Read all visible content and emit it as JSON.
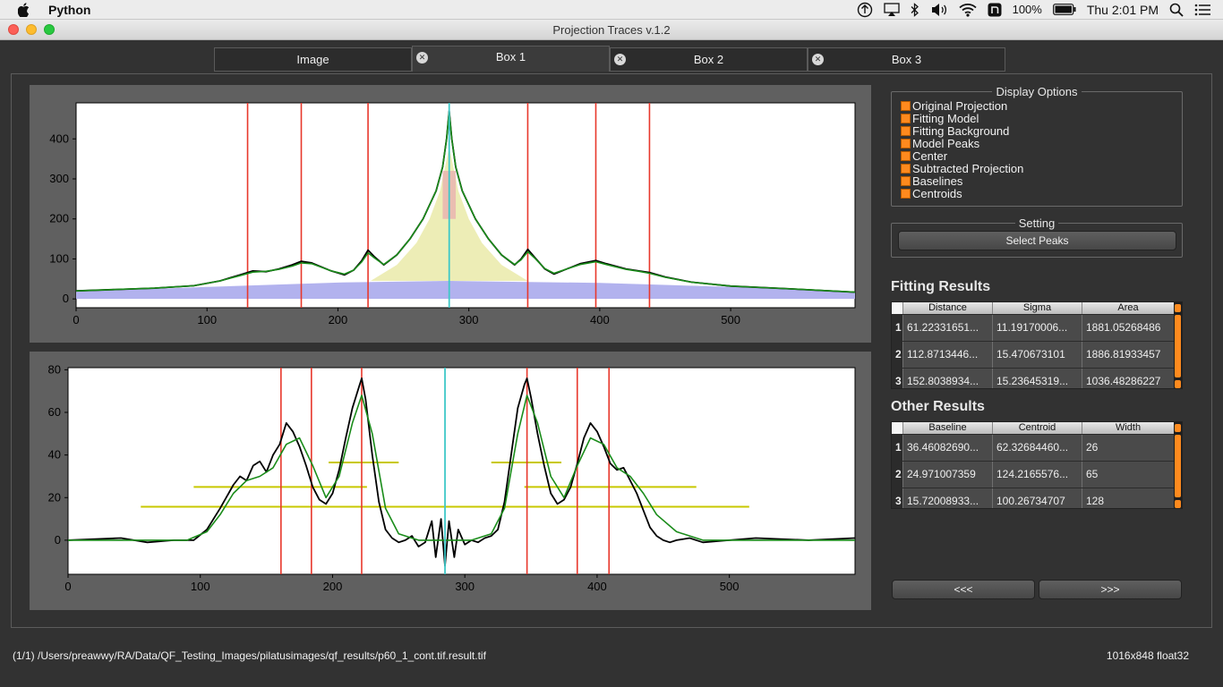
{
  "menubar": {
    "app_name": "Python",
    "battery": "100%",
    "clock": "Thu 2:01 PM"
  },
  "window": {
    "title": "Projection Traces v.1.2"
  },
  "tabs": [
    {
      "label": "Image"
    },
    {
      "label": "Box 1",
      "close": "✕"
    },
    {
      "label": "Box 2",
      "close": "✕"
    },
    {
      "label": "Box 3",
      "close": "✕"
    }
  ],
  "display_options": {
    "title": "Display Options",
    "options": [
      "Original Projection",
      "Fitting Model",
      "Fitting Background",
      "Model Peaks",
      "Center",
      "Subtracted Projection",
      "Baselines",
      "Centroids"
    ],
    "checkbox_color": "#ff8a1e"
  },
  "setting": {
    "title": "Setting",
    "select_peaks_label": "Select Peaks"
  },
  "fitting_results": {
    "title": "Fitting Results",
    "columns": [
      "Distance",
      "Sigma",
      "Area"
    ],
    "rows": [
      {
        "index": "1",
        "cells": [
          "61.22331651...",
          "11.19170006...",
          "1881.05268486"
        ]
      },
      {
        "index": "2",
        "cells": [
          "112.8713446...",
          "15.470673101",
          "1886.81933457"
        ]
      },
      {
        "index": "3",
        "cells": [
          "152.8038934...",
          "15.23645319...",
          "1036.48286227"
        ]
      }
    ]
  },
  "other_results": {
    "title": "Other Results",
    "columns": [
      "Baseline",
      "Centroid",
      "Width"
    ],
    "rows": [
      {
        "index": "1",
        "cells": [
          "36.46082690...",
          "62.32684460...",
          "26"
        ]
      },
      {
        "index": "2",
        "cells": [
          "24.971007359",
          "124.2165576...",
          "65"
        ]
      },
      {
        "index": "3",
        "cells": [
          "15.72008933...",
          "100.26734707",
          "128"
        ]
      }
    ]
  },
  "nav": {
    "prev_label": "<<<",
    "next_label": ">>>"
  },
  "status": {
    "path": "(1/1) /Users/preawwy/RA/Data/QF_Testing_Images/pilatusimages/qf_results/p60_1_cont.tif.result.tif",
    "image_info": "1016x848 float32"
  },
  "colors": {
    "peak_line": "#e8382c",
    "center_line": "#3fc8c8",
    "fit_curve": "#1a8c1a",
    "raw_curve": "#000000",
    "background_fill": "#b2b2ee",
    "model_peak_fill": "#ececb2",
    "baseline": "#c8c800"
  },
  "chart_data": [
    {
      "type": "line",
      "name": "top-projection",
      "xlim": [
        0,
        595
      ],
      "ylim": [
        -22,
        490
      ],
      "xticks": [
        0,
        100,
        200,
        300,
        400,
        500
      ],
      "yticks": [
        0,
        100,
        200,
        300,
        400
      ],
      "center": 285,
      "peak_lines": [
        131,
        172,
        223,
        345,
        397,
        438
      ],
      "series": [
        {
          "name": "Original Projection",
          "x": [
            0,
            60,
            90,
            110,
            125,
            135,
            145,
            155,
            165,
            172,
            180,
            195,
            205,
            212,
            218,
            223,
            228,
            235,
            245,
            255,
            265,
            275,
            280,
            283,
            285,
            287,
            290,
            295,
            305,
            315,
            325,
            335,
            340,
            345,
            350,
            358,
            365,
            375,
            385,
            397,
            405,
            420,
            430,
            438,
            450,
            470,
            500,
            540,
            595
          ],
          "y": [
            20,
            27,
            33,
            45,
            60,
            70,
            68,
            75,
            85,
            94,
            90,
            70,
            60,
            72,
            95,
            122,
            105,
            85,
            110,
            150,
            200,
            270,
            330,
            400,
            470,
            400,
            330,
            270,
            200,
            150,
            110,
            85,
            100,
            124,
            105,
            75,
            62,
            75,
            88,
            96,
            88,
            75,
            70,
            66,
            55,
            42,
            32,
            26,
            17
          ]
        },
        {
          "name": "Fitting Model",
          "x": [
            0,
            60,
            90,
            110,
            125,
            135,
            145,
            155,
            165,
            172,
            180,
            195,
            205,
            212,
            218,
            223,
            228,
            235,
            245,
            255,
            265,
            275,
            280,
            283,
            285,
            287,
            290,
            295,
            305,
            315,
            325,
            335,
            340,
            345,
            350,
            358,
            365,
            375,
            385,
            397,
            405,
            420,
            430,
            438,
            450,
            470,
            500,
            540,
            595
          ],
          "y": [
            20,
            27,
            33,
            45,
            58,
            67,
            69,
            74,
            82,
            90,
            88,
            70,
            62,
            72,
            92,
            115,
            102,
            86,
            110,
            150,
            200,
            270,
            330,
            400,
            468,
            400,
            330,
            270,
            200,
            150,
            110,
            86,
            98,
            118,
            103,
            76,
            64,
            75,
            86,
            93,
            86,
            74,
            69,
            64,
            54,
            42,
            32,
            26,
            17
          ]
        },
        {
          "name": "Fitting Background",
          "x": [
            0,
            100,
            200,
            285,
            400,
            500,
            595
          ],
          "y": [
            18,
            30,
            41,
            45,
            40,
            30,
            18
          ]
        },
        {
          "name": "Model Peaks",
          "x": [
            225,
            245,
            260,
            270,
            278,
            285,
            292,
            300,
            310,
            325,
            345
          ],
          "y": [
            45,
            85,
            140,
            200,
            270,
            380,
            270,
            200,
            140,
            85,
            45
          ]
        }
      ]
    },
    {
      "type": "line",
      "name": "subtracted-projection",
      "xlim": [
        0,
        595
      ],
      "ylim": [
        -16,
        81
      ],
      "xticks": [
        0,
        100,
        200,
        300,
        400,
        500
      ],
      "yticks": [
        0,
        20,
        40,
        60,
        80
      ],
      "center": 285,
      "peak_lines": [
        161,
        184,
        222,
        347,
        385,
        409
      ],
      "series": [
        {
          "name": "Subtracted Projection",
          "x": [
            0,
            40,
            60,
            80,
            95,
            105,
            115,
            125,
            130,
            135,
            140,
            145,
            150,
            155,
            160,
            165,
            170,
            175,
            180,
            185,
            190,
            195,
            200,
            205,
            210,
            215,
            220,
            222,
            225,
            230,
            235,
            240,
            245,
            250,
            255,
            260,
            265,
            270,
            275,
            278,
            282,
            285,
            288,
            292,
            295,
            300,
            305,
            310,
            315,
            320,
            325,
            330,
            335,
            340,
            345,
            347,
            350,
            355,
            360,
            365,
            370,
            375,
            380,
            385,
            390,
            395,
            400,
            405,
            410,
            415,
            420,
            425,
            430,
            435,
            440,
            445,
            450,
            455,
            460,
            470,
            480,
            500,
            520,
            560,
            595
          ],
          "y": [
            0,
            1,
            -1,
            0,
            0,
            5,
            15,
            26,
            30,
            28,
            35,
            37,
            32,
            40,
            45,
            55,
            51,
            44,
            35,
            25,
            19,
            17,
            22,
            33,
            48,
            62,
            72,
            76,
            66,
            40,
            18,
            5,
            1,
            -1,
            0,
            2,
            -3,
            -1,
            9,
            -8,
            10,
            -12,
            9,
            -8,
            5,
            -2,
            0,
            -1,
            1,
            2,
            5,
            18,
            40,
            62,
            73,
            76,
            67,
            50,
            35,
            22,
            17,
            19,
            25,
            36,
            48,
            55,
            51,
            44,
            36,
            33,
            34,
            28,
            22,
            14,
            6,
            2,
            0,
            -1,
            0,
            1,
            -1,
            0,
            1,
            0,
            1
          ]
        },
        {
          "name": "Fitting Model",
          "x": [
            0,
            90,
            105,
            115,
            125,
            135,
            145,
            155,
            165,
            175,
            185,
            195,
            205,
            215,
            222,
            230,
            240,
            250,
            265,
            285,
            305,
            320,
            330,
            340,
            347,
            355,
            365,
            375,
            385,
            395,
            405,
            415,
            425,
            435,
            445,
            460,
            480,
            595
          ],
          "y": [
            0,
            0,
            4,
            12,
            22,
            28,
            30,
            34,
            45,
            48,
            35,
            20,
            30,
            55,
            68,
            50,
            15,
            3,
            0,
            0,
            0,
            3,
            15,
            50,
            68,
            55,
            30,
            20,
            35,
            48,
            45,
            34,
            30,
            22,
            12,
            4,
            0,
            0
          ]
        }
      ],
      "baselines": [
        {
          "y": 36.5,
          "x0": 197,
          "x1": 250
        },
        {
          "y": 36.5,
          "x0": 320,
          "x1": 373
        },
        {
          "y": 25,
          "x0": 95,
          "x1": 226
        },
        {
          "y": 25,
          "x0": 345,
          "x1": 475
        },
        {
          "y": 15.7,
          "x0": 55,
          "x1": 515
        }
      ]
    }
  ]
}
